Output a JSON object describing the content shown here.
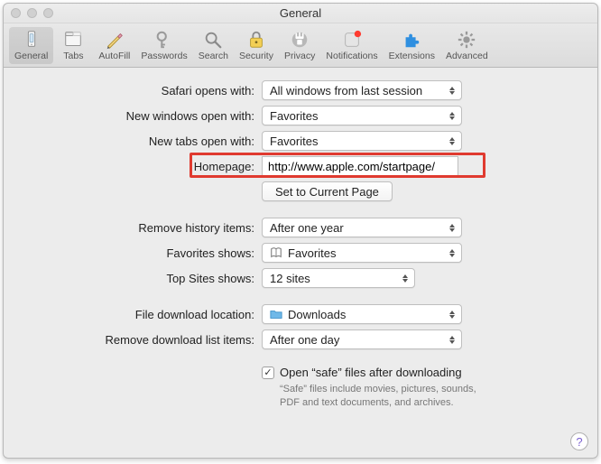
{
  "window": {
    "title": "General"
  },
  "toolbar": {
    "items": [
      {
        "label": "General",
        "icon": "general-icon",
        "selected": true
      },
      {
        "label": "Tabs",
        "icon": "tabs-icon",
        "selected": false
      },
      {
        "label": "AutoFill",
        "icon": "autofill-icon",
        "selected": false
      },
      {
        "label": "Passwords",
        "icon": "passwords-icon",
        "selected": false
      },
      {
        "label": "Search",
        "icon": "search-icon",
        "selected": false
      },
      {
        "label": "Security",
        "icon": "security-icon",
        "selected": false
      },
      {
        "label": "Privacy",
        "icon": "privacy-icon",
        "selected": false
      },
      {
        "label": "Notifications",
        "icon": "notifications-icon",
        "selected": false,
        "badge": true
      },
      {
        "label": "Extensions",
        "icon": "extensions-icon",
        "selected": false
      },
      {
        "label": "Advanced",
        "icon": "advanced-icon",
        "selected": false
      }
    ]
  },
  "form": {
    "safari_opens_with": {
      "label": "Safari opens with:",
      "value": "All windows from last session"
    },
    "new_windows": {
      "label": "New windows open with:",
      "value": "Favorites"
    },
    "new_tabs": {
      "label": "New tabs open with:",
      "value": "Favorites"
    },
    "homepage": {
      "label": "Homepage:",
      "value": "http://www.apple.com/startpage/"
    },
    "set_current": {
      "label": "Set to Current Page"
    },
    "remove_history": {
      "label": "Remove history items:",
      "value": "After one year"
    },
    "favorites_shows": {
      "label": "Favorites shows:",
      "value": "Favorites",
      "icon": "book-icon"
    },
    "top_sites": {
      "label": "Top Sites shows:",
      "value": "12 sites"
    },
    "download_location": {
      "label": "File download location:",
      "value": "Downloads",
      "icon": "folder-icon"
    },
    "remove_downloads": {
      "label": "Remove download list items:",
      "value": "After one day"
    },
    "open_safe": {
      "label": "Open “safe” files after downloading",
      "checked": true,
      "caption": "“Safe” files include movies, pictures, sounds, PDF and text documents, and archives."
    }
  },
  "help_glyph": "?"
}
